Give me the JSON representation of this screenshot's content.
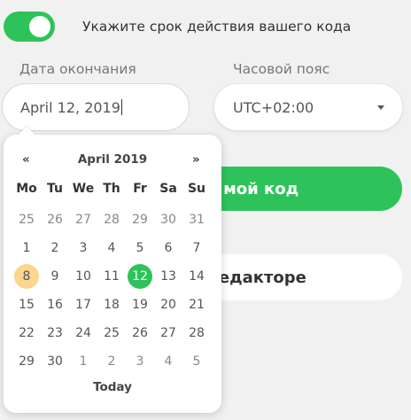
{
  "toggle": {
    "label": "Укажите срок действия вашего кода",
    "on": true
  },
  "end_date": {
    "label": "Дата окончания",
    "value": "April 12, 2019"
  },
  "timezone": {
    "label": "Часовой пояс",
    "value": "UTC+02:00"
  },
  "primary_button": {
    "visible_text": "ть мой код"
  },
  "secondary_button": {
    "visible_text": "редакторе"
  },
  "colors": {
    "accent": "#2ec35a",
    "today_highlight": "#fcd58f"
  },
  "calendar": {
    "prev": "«",
    "next": "»",
    "title": "April 2019",
    "weekdays": [
      "Mo",
      "Tu",
      "We",
      "Th",
      "Fr",
      "Sa",
      "Su"
    ],
    "weeks": [
      [
        "25",
        "26",
        "27",
        "28",
        "29",
        "30",
        "31"
      ],
      [
        "1",
        "2",
        "3",
        "4",
        "5",
        "6",
        "7"
      ],
      [
        "8",
        "9",
        "10",
        "11",
        "12",
        "13",
        "14"
      ],
      [
        "15",
        "16",
        "17",
        "18",
        "19",
        "20",
        "21"
      ],
      [
        "22",
        "23",
        "24",
        "25",
        "26",
        "27",
        "28"
      ],
      [
        "29",
        "30",
        "1",
        "2",
        "3",
        "4",
        "5"
      ]
    ],
    "today_label": "Today",
    "today_day": "8",
    "selected_day": "12"
  }
}
